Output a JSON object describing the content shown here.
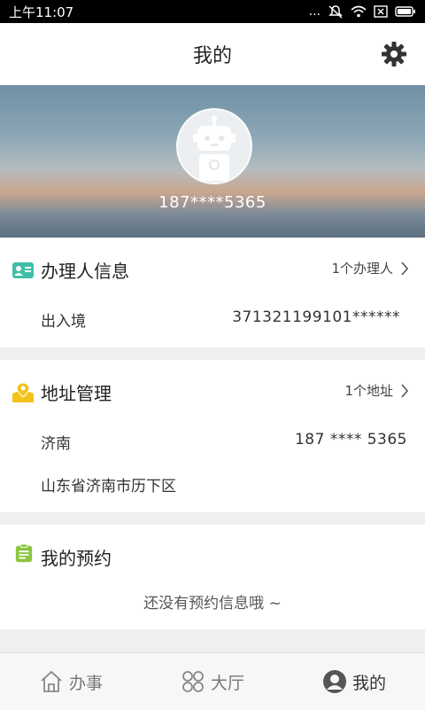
{
  "status_bar": {
    "time": "上午11:07",
    "dots": "...",
    "battery_label": ""
  },
  "header": {
    "title": "我的"
  },
  "profile": {
    "phone": "187****5365"
  },
  "applicant": {
    "title": "办理人信息",
    "count_label": "1个办理人",
    "rows": [
      {
        "label": "出入境",
        "value": "371321199101******"
      }
    ]
  },
  "address": {
    "title": "地址管理",
    "count_label": "1个地址",
    "name": "济南",
    "phone": "187 **** 5365",
    "detail": "山东省济南市历下区"
  },
  "appointment": {
    "title": "我的预约",
    "empty_text": "还没有预约信息哦 ~"
  },
  "bottom_nav": [
    {
      "label": "办事",
      "icon": "home-icon",
      "active": false
    },
    {
      "label": "大厅",
      "icon": "hall-grid-icon",
      "active": false
    },
    {
      "label": "我的",
      "icon": "user-icon",
      "active": true
    }
  ],
  "colors": {
    "applicant_icon": "#3fbfa8",
    "address_icon": "#f4c21a",
    "appointment_icon": "#8cc63f"
  }
}
